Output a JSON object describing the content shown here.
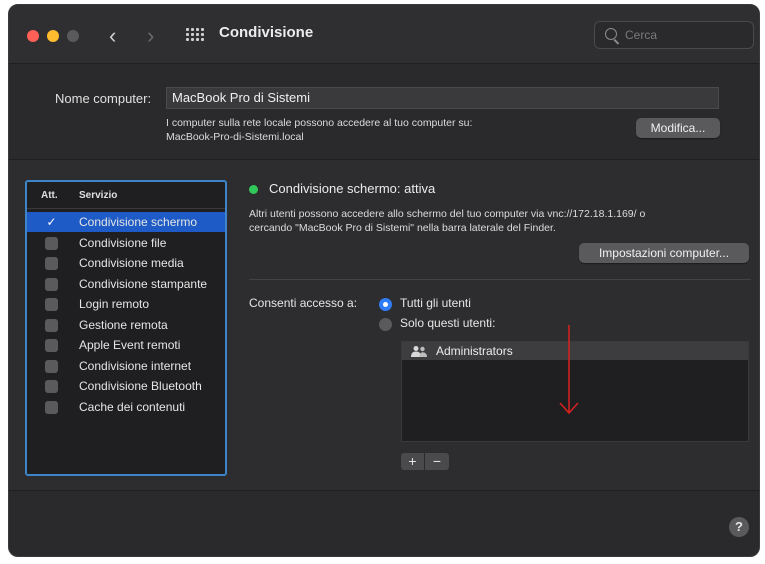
{
  "window": {
    "title": "Condivisione",
    "nav": {
      "back": "‹",
      "forward": "›"
    },
    "search": {
      "placeholder": "Cerca"
    }
  },
  "computer": {
    "name_label": "Nome computer:",
    "name_value": "MacBook Pro di Sistemi",
    "info_line1": "I computer sulla rete locale possono accedere al tuo computer su:",
    "info_line2": "MacBook-Pro-di-Sistemi.local",
    "edit_button": "Modifica..."
  },
  "services": {
    "header_att": "Att.",
    "header_service": "Servizio",
    "items": [
      {
        "label": "Condivisione schermo",
        "checked": true,
        "selected": true
      },
      {
        "label": "Condivisione file",
        "checked": false
      },
      {
        "label": "Condivisione media",
        "checked": false
      },
      {
        "label": "Condivisione stampante",
        "checked": false
      },
      {
        "label": "Login remoto",
        "checked": false
      },
      {
        "label": "Gestione remota",
        "checked": false
      },
      {
        "label": "Apple Event remoti",
        "checked": false
      },
      {
        "label": "Condivisione internet",
        "checked": false
      },
      {
        "label": "Condivisione Bluetooth",
        "checked": false
      },
      {
        "label": "Cache dei contenuti",
        "checked": false
      }
    ]
  },
  "detail": {
    "status": "Condivisione schermo: attiva",
    "status_color": "#30c85a",
    "desc_line1": "Altri utenti possono accedere allo schermo del tuo computer via vnc://172.18.1.169/ o",
    "desc_line2": "cercando \"MacBook Pro di Sistemi\" nella barra laterale del Finder.",
    "settings_button": "Impostazioni computer...",
    "access_label": "Consenti accesso a:",
    "radio_all": "Tutti gli utenti",
    "radio_only": "Solo questi utenti:",
    "users": [
      "Administrators"
    ],
    "add": "+",
    "remove": "−"
  },
  "help": "?",
  "colors": {
    "accent": "#2f7cf6",
    "selection": "#1e5bc6",
    "annotation_arrow": "#d9221f"
  }
}
